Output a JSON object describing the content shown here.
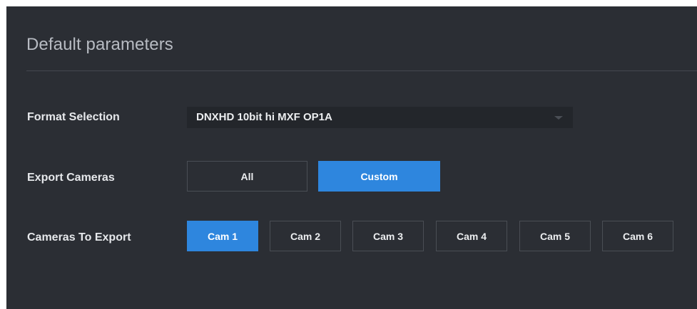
{
  "panel": {
    "title": "Default parameters"
  },
  "format_selection": {
    "label": "Format Selection",
    "value": "DNXHD 10bit hi MXF OP1A"
  },
  "export_cameras": {
    "label": "Export Cameras",
    "options": [
      {
        "label": "All",
        "selected": false
      },
      {
        "label": "Custom",
        "selected": true
      }
    ]
  },
  "cameras_to_export": {
    "label": "Cameras To Export",
    "cameras": [
      {
        "label": "Cam 1",
        "selected": true
      },
      {
        "label": "Cam 2",
        "selected": false
      },
      {
        "label": "Cam 3",
        "selected": false
      },
      {
        "label": "Cam 4",
        "selected": false
      },
      {
        "label": "Cam 5",
        "selected": false
      },
      {
        "label": "Cam 6",
        "selected": false
      }
    ]
  },
  "colors": {
    "panel_background": "#2b2e34",
    "accent": "#2e86de",
    "dropdown_background": "#23262b"
  }
}
